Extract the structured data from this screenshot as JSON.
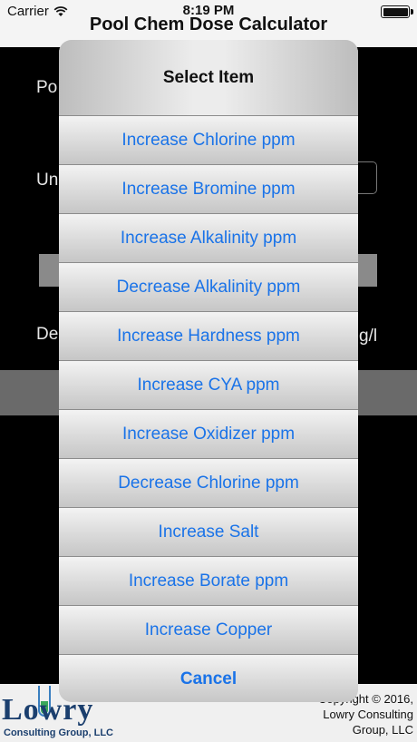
{
  "status_bar": {
    "carrier": "Carrier",
    "time": "8:19 PM"
  },
  "app": {
    "title": "Pool Chem Dose Calculator",
    "background_labels": [
      "Po",
      "Un",
      "De",
      "g/l"
    ]
  },
  "action_sheet": {
    "title": "Select Item",
    "items": [
      "Increase Chlorine ppm",
      "Increase Bromine ppm",
      "Increase Alkalinity ppm",
      "Decrease Alkalinity ppm",
      "Increase Hardness ppm",
      "Increase CYA ppm",
      "Increase Oxidizer ppm",
      "Decrease Chlorine ppm",
      "Increase Salt",
      "Increase Borate ppm",
      "Increase Copper"
    ],
    "cancel": "Cancel"
  },
  "footer": {
    "logo_word": "Lowry",
    "logo_sub": "Consulting Group, LLC",
    "copyright_lines": [
      "Copyright © 2016,",
      "Lowry Consulting",
      "Group, LLC"
    ]
  },
  "colors": {
    "link_blue": "#1a73e8",
    "logo_navy": "#1b3f6e"
  }
}
